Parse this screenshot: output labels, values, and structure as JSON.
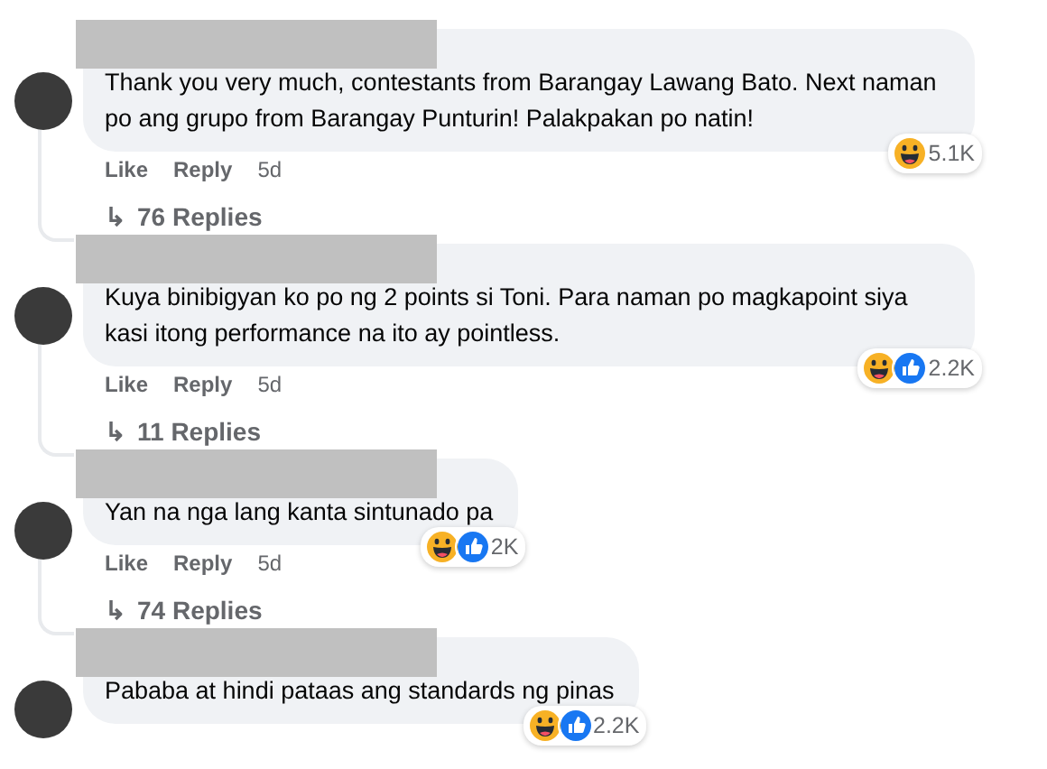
{
  "comments": [
    {
      "text": "Thank you very much, contestants from Barangay Lawang Bato. Next naman po ang grupo from Barangay Punturin! Palakpakan po natin!",
      "like": "Like",
      "reply": "Reply",
      "time": "5d",
      "reactions": [
        {
          "kind": "haha"
        }
      ],
      "reaction_count": "5.1K",
      "replies": "76 Replies",
      "reply_arrow": "↳"
    },
    {
      "text": "Kuya binibigyan ko po ng 2 points si Toni. Para naman po magkapoint siya kasi itong performance na ito ay pointless.",
      "like": "Like",
      "reply": "Reply",
      "time": "5d",
      "reactions": [
        {
          "kind": "haha"
        },
        {
          "kind": "like"
        }
      ],
      "reaction_count": "2.2K",
      "replies": "11 Replies",
      "reply_arrow": "↳"
    },
    {
      "text": "Yan na nga lang kanta sintunado pa",
      "like": "Like",
      "reply": "Reply",
      "time": "5d",
      "reactions": [
        {
          "kind": "haha"
        },
        {
          "kind": "like"
        }
      ],
      "reaction_count": "2K",
      "replies": "74 Replies",
      "reply_arrow": "↳"
    },
    {
      "text": "Pababa at hindi pataas ang standards ng pinas",
      "reactions": [
        {
          "kind": "haha"
        },
        {
          "kind": "like"
        }
      ],
      "reaction_count": "2.2K"
    }
  ]
}
